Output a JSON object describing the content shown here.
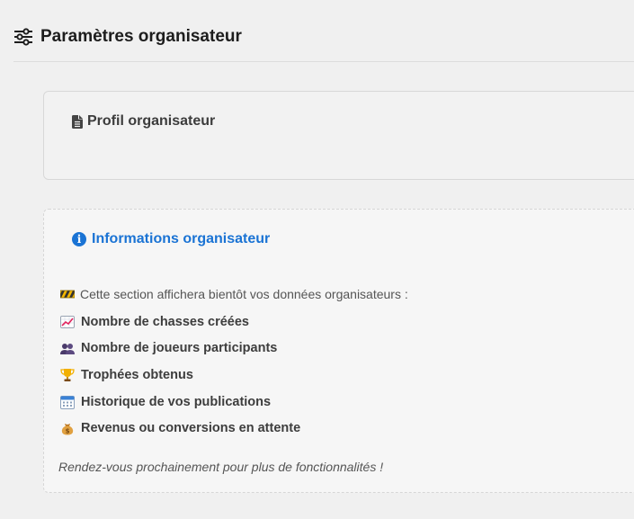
{
  "header": {
    "title": "Paramètres organisateur",
    "icon": "sliders-icon"
  },
  "profile_card": {
    "title": "Profil organisateur",
    "icon": "file-icon"
  },
  "info_card": {
    "title": "Informations organisateur",
    "icon": "info-circle-icon",
    "accent_color": "#1a73d4",
    "intro": "Cette section affichera bientôt vos données organisateurs :",
    "intro_icon": "construction-icon",
    "items": [
      {
        "label": "Nombre de chasses créées",
        "icon": "chart-increasing-icon"
      },
      {
        "label": "Nombre de joueurs participants",
        "icon": "people-icon"
      },
      {
        "label": "Trophées obtenus",
        "icon": "trophy-icon"
      },
      {
        "label": "Historique de vos publications",
        "icon": "calendar-icon"
      },
      {
        "label": "Revenus ou conversions en attente",
        "icon": "money-bag-icon"
      }
    ],
    "closing": "Rendez-vous prochainement pour plus de fonctionnalités !"
  }
}
